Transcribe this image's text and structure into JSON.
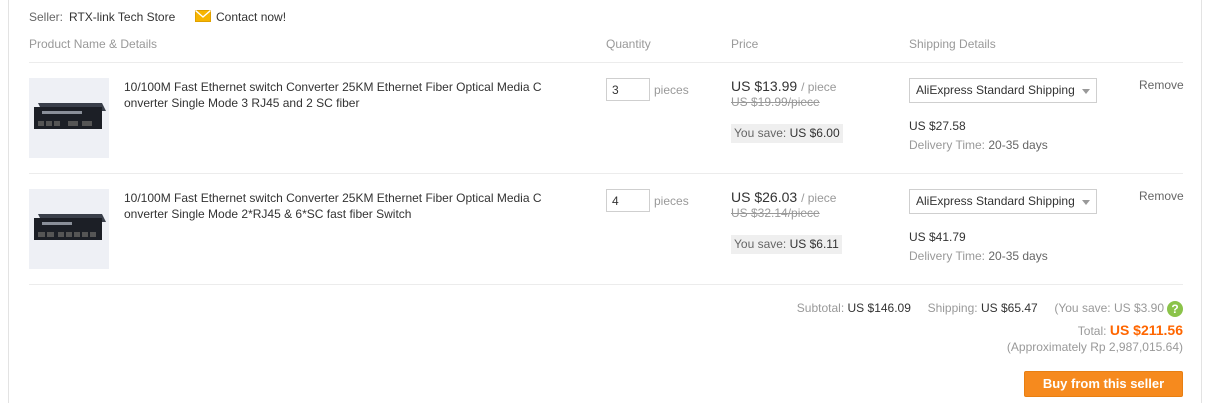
{
  "seller": {
    "label": "Seller:",
    "name": "RTX-link Tech Store",
    "contact_label": "Contact now!"
  },
  "columns": {
    "product": "Product Name & Details",
    "quantity": "Quantity",
    "price": "Price",
    "shipping": "Shipping Details"
  },
  "items": [
    {
      "title": "10/100M Fast Ethernet switch Converter 25KM Ethernet Fiber Optical Media Converter Single Mode 3 RJ45 and 2 SC fiber",
      "quantity": "3",
      "pieces_label": "pieces",
      "price": "US $13.99",
      "per_piece": "/ piece",
      "original_price": "US $19.99/piece",
      "save_label": "You save:",
      "save_amount": "US $6.00",
      "shipping_method": "AliExpress Standard Shipping",
      "shipping_cost": "US $27.58",
      "delivery_label": "Delivery Time:",
      "delivery_time": "20-35 days",
      "remove_label": "Remove"
    },
    {
      "title": "10/100M Fast Ethernet switch Converter 25KM Ethernet Fiber Optical Media Converter Single Mode 2*RJ45 & 6*SC fast fiber Switch",
      "quantity": "4",
      "pieces_label": "pieces",
      "price": "US $26.03",
      "per_piece": "/ piece",
      "original_price": "US $32.14/piece",
      "save_label": "You save:",
      "save_amount": "US $6.11",
      "shipping_method": "AliExpress Standard Shipping",
      "shipping_cost": "US $41.79",
      "delivery_label": "Delivery Time:",
      "delivery_time": "20-35 days",
      "remove_label": "Remove"
    }
  ],
  "summary": {
    "subtotal_label": "Subtotal:",
    "subtotal": "US $146.09",
    "shipping_label": "Shipping:",
    "shipping": "US $65.47",
    "you_save": "(You save: US $3.90",
    "help_icon_symbol": "?",
    "total_label": "Total:",
    "total": "US $211.56",
    "approx": "(Approximately Rp 2,987,015.64)",
    "buy_button": "Buy from this seller"
  },
  "colors": {
    "accent": "#f60",
    "button": "#f68a1e",
    "help_icon": "#8bc34a"
  },
  "icons": {
    "mail": "envelope-icon",
    "help": "question-icon"
  }
}
